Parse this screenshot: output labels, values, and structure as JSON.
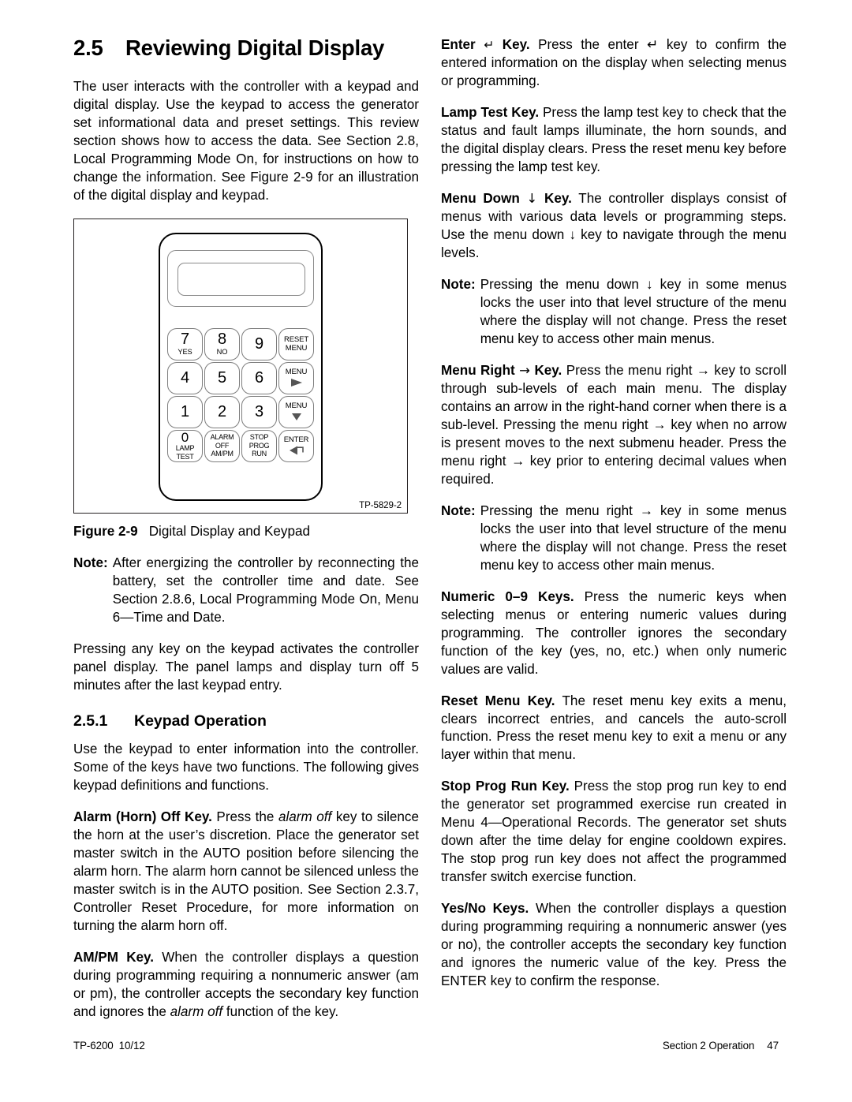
{
  "document": {
    "footer_left_doc": "TP-6200",
    "footer_left_rev": "10/12",
    "footer_right_section": "Section 2  Operation",
    "footer_right_page": "47"
  },
  "left_column": {
    "section_number": "2.5",
    "section_title": "Reviewing Digital Display",
    "intro_paragraph": "The user interacts with the controller with a keypad and digital display.  Use the keypad to access the generator set informational data and preset settings.  This review section shows how to access the data.  See Section 2.8, Local Programming Mode On, for instructions on how to change the information.   See Figure 2-9 for an illustration of the digital display and keypad.",
    "figure": {
      "id_label": "TP-5829-2",
      "caption_number": "Figure 2-9",
      "caption_text": "Digital Display and Keypad",
      "keys": [
        {
          "name": "key-7-yes",
          "digit": "7",
          "sub": "YES",
          "lines": []
        },
        {
          "name": "key-8-no",
          "digit": "8",
          "sub": "NO",
          "lines": []
        },
        {
          "name": "key-9",
          "digit": "9",
          "sub": "",
          "lines": []
        },
        {
          "name": "key-reset-menu",
          "digit": "",
          "sub": "",
          "lines": [
            "RESET",
            "MENU"
          ]
        },
        {
          "name": "key-4",
          "digit": "4",
          "sub": "",
          "lines": []
        },
        {
          "name": "key-5",
          "digit": "5",
          "sub": "",
          "lines": []
        },
        {
          "name": "key-6",
          "digit": "6",
          "sub": "",
          "lines": []
        },
        {
          "name": "key-menu-right",
          "digit": "",
          "sub": "",
          "lines": [
            "MENU"
          ],
          "icon": "arrow-right-icon"
        },
        {
          "name": "key-1",
          "digit": "1",
          "sub": "",
          "lines": []
        },
        {
          "name": "key-2",
          "digit": "2",
          "sub": "",
          "lines": []
        },
        {
          "name": "key-3",
          "digit": "3",
          "sub": "",
          "lines": []
        },
        {
          "name": "key-menu-down",
          "digit": "",
          "sub": "",
          "lines": [
            "MENU"
          ],
          "icon": "arrow-down-icon"
        },
        {
          "name": "key-0-lamp-test",
          "digit": "0",
          "sub": "",
          "lines": [
            "LAMP",
            "TEST"
          ]
        },
        {
          "name": "key-alarm-off-ampm",
          "digit": "",
          "sub": "",
          "lines": [
            "ALARM",
            "OFF",
            "AM/PM"
          ]
        },
        {
          "name": "key-stop-prog-run",
          "digit": "",
          "sub": "",
          "lines": [
            "STOP",
            "PROG",
            "RUN"
          ]
        },
        {
          "name": "key-enter",
          "digit": "",
          "sub": "",
          "lines": [
            "ENTER"
          ],
          "icon": "enter-arrow-icon"
        }
      ]
    },
    "note_after_figure": {
      "label": "Note:",
      "text": "After energizing the controller by reconnecting the battery, set the controller time and date.  See Section 2.8.6, Local Programming Mode On, Menu 6—Time and Date."
    },
    "paragraph_panel_display": "Pressing any key on the keypad activates the controller panel display.  The panel lamps and display turn off 5 minutes after the last keypad entry.",
    "subsection_number": "2.5.1",
    "subsection_title": "Keypad Operation",
    "paragraph_keypad_intro": "Use the keypad to enter information into the controller. Some of the keys have two functions.  The following gives keypad definitions and functions.",
    "alarm_off_key": {
      "heading": "Alarm (Horn) Off Key.",
      "text_1": "  Press the ",
      "italic_1": "alarm off",
      "text_2": " key to silence the horn at the user’s discretion.  Place the generator set master switch in the AUTO position before silencing the alarm horn.  The alarm horn cannot be silenced unless the master switch is in the AUTO position. See Section 2.3.7, Controller Reset Procedure, for more information on turning the alarm horn off."
    },
    "ampm_key": {
      "heading": "AM/PM Key.",
      "text_1": "  When the controller displays a question during programming requiring a nonnumeric answer (am or pm), the controller accepts the secondary key function and ignores the ",
      "italic_1": "alarm off",
      "text_2": " function of the key."
    }
  },
  "right_column": {
    "enter_key": {
      "heading_1": "Enter",
      "glyph": "↵",
      "heading_2": "Key.",
      "text": "  Press the enter ↵ key to confirm the entered information on the display when selecting menus or programming."
    },
    "lamp_test_key": {
      "heading": "Lamp Test Key.",
      "text": "  Press the lamp test key to check that the status and fault lamps illuminate, the horn sounds, and the digital display clears.  Press the reset menu key before pressing the lamp test key."
    },
    "menu_down_key": {
      "heading_1": "Menu Down",
      "glyph": "↓",
      "heading_2": "Key.",
      "text": "  The controller displays consist of menus with various data levels or programming steps. Use the menu down ↓ key to navigate through the menu levels."
    },
    "note_menu_down": {
      "label": "Note:",
      "text": "Pressing the menu down ↓ key in some menus locks the user into that level structure of the menu where the display will not change. Press the reset menu key to access other main menus."
    },
    "menu_right_key": {
      "heading_1": "Menu Right",
      "glyph": "→",
      "heading_2": "Key.",
      "text": "  Press the menu right → key to scroll through sub-levels of each main menu.  The display contains an arrow in the right-hand corner when there is a sub-level.  Pressing the menu right → key when no arrow is present moves to the next submenu header.  Press the menu right → key prior to entering decimal values when required."
    },
    "note_menu_right": {
      "label": "Note:",
      "text": "Pressing the menu right → key in some menus locks the user into that level structure of the menu where the display will not change. Press the reset menu key to access other main menus."
    },
    "numeric_keys": {
      "heading": "Numeric 0–9 Keys.",
      "text": "  Press the numeric keys when selecting menus or entering numeric values during programming.  The controller ignores the secondary function of the key (yes, no, etc.) when only numeric values are valid."
    },
    "reset_menu_key": {
      "heading": "Reset Menu Key.",
      "text": "  The reset menu key exits a menu, clears incorrect entries, and cancels the auto-scroll function. Press the reset menu key to exit a menu or any layer within that menu."
    },
    "stop_prog_run_key": {
      "heading": "Stop Prog Run Key.",
      "text": " Press the stop prog run key to end the generator set programmed exercise run created in Menu 4—Operational Records. The generator set shuts down after the time delay for engine cooldown expires. The stop prog run key does not affect the programmed transfer switch exercise function."
    },
    "yes_no_keys": {
      "heading": "Yes/No Keys.",
      "text": "  When the controller displays a question during programming requiring a nonnumeric answer (yes or no), the controller accepts the secondary key function and ignores the numeric value of the key.  Press the ENTER key to confirm the response."
    }
  }
}
